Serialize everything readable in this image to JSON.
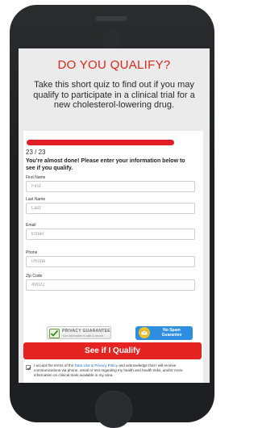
{
  "page": {
    "heading": "DO YOU QUALIFY?",
    "intro": "Take this short quiz to find out if you may qualify to participate in a clinical trial for a new cholesterol-lowering drug."
  },
  "form": {
    "progress": 1.0,
    "step": "23 / 23",
    "headline": "You're almost done! Please enter your information below to see if you qualify.",
    "fields": [
      {
        "label": "First Name",
        "placeholder": "First",
        "value": ""
      },
      {
        "label": "Last Name",
        "placeholder": "Last",
        "value": ""
      },
      {
        "label": "Email",
        "placeholder": "Email",
        "value": ""
      },
      {
        "label": "Phone",
        "placeholder": "Phone",
        "value": ""
      },
      {
        "label": "Zip Code",
        "placeholder": "49022",
        "value": ""
      }
    ],
    "privacy_badge": {
      "title": "PRIVACY GUARANTEE",
      "subtitle": "Your information is safe & secure",
      "icon": "checkmark-shield-icon"
    },
    "spam_badge": {
      "line1": "No Spam",
      "line2": "Guarantee",
      "icon": "envelope-icon"
    },
    "submit_label": "See if I Qualify",
    "consent": {
      "checked": true,
      "text_before": "I accept the terms of the ",
      "link_text": "Data Use & Privacy Policy",
      "text_after": " and acknowledge that I will receive communications via phone, email or text regarding my health and health risks, and/or more information on clinical trials available in my area."
    }
  },
  "colors": {
    "accent": "#e01e26",
    "link": "#1d6fd1",
    "phone": "#1e1f22",
    "spam_badge": "#2e8fe0"
  }
}
